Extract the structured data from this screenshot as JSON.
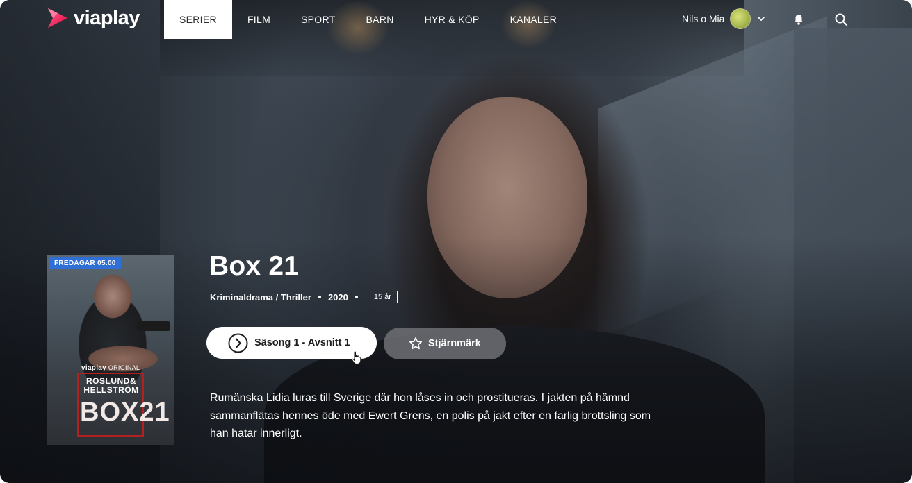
{
  "brand": {
    "name": "viaplay"
  },
  "nav": {
    "items": [
      {
        "label": "SERIER",
        "active": true
      },
      {
        "label": "FILM",
        "active": false
      },
      {
        "label": "SPORT",
        "active": false
      },
      {
        "label": "BARN",
        "active": false
      },
      {
        "label": "HYR & KÖP",
        "active": false
      },
      {
        "label": "KANALER",
        "active": false
      }
    ]
  },
  "profile": {
    "name": "Nils o Mia"
  },
  "icons": {
    "notifications": "bell-icon",
    "search": "search-icon",
    "profile_menu": "chevron-down-icon"
  },
  "poster": {
    "badge": "FREDAGAR 05.00",
    "original_brand": "viaplay",
    "original_label": "ORIGINAL",
    "authors_line1": "ROSLUND&",
    "authors_line2": "HELLSTRÖM",
    "title": "BOX21"
  },
  "show": {
    "title": "Box 21",
    "genre": "Kriminaldrama / Thriller",
    "year": "2020",
    "age_rating": "15 år",
    "play_label": "Säsong 1 - Avsnitt 1",
    "favorite_label": "Stjärnmärk",
    "description": "Rumänska Lidia luras till Sverige där hon låses in och prostitueras. I jakten på hämnd sammanflätas hennes öde med Ewert Grens, en polis på jakt efter en farlig brottsling som han hatar innerligt."
  },
  "colors": {
    "brand_red": "#e6003e",
    "brand_pink": "#ff5a8a",
    "badge_blue": "#2f6fd6",
    "active_nav_bg": "#ffffff"
  }
}
